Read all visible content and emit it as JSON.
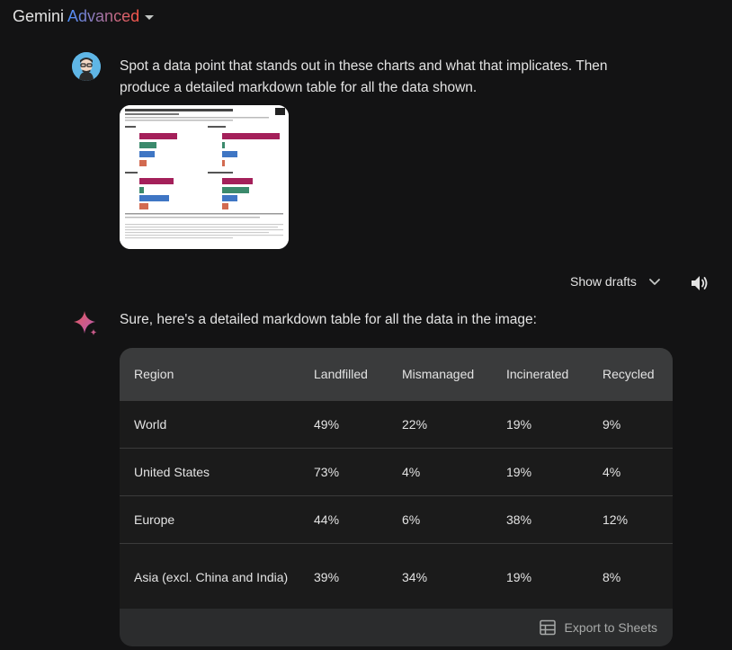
{
  "app": {
    "name_prefix": "Gemini",
    "name_suffix": "Advanced"
  },
  "user_message": "Spot a data point that stands out in these charts and what that implicates. Then produce a detailed markdown table for all the data shown.",
  "drafts": {
    "label": "Show drafts"
  },
  "reply": {
    "intro": "Sure, here's a detailed markdown table for all the data in the image:",
    "table": {
      "headers": [
        "Region",
        "Landfilled",
        "Mismanaged",
        "Incinerated",
        "Recycled"
      ],
      "rows": [
        [
          "World",
          "49%",
          "22%",
          "19%",
          "9%"
        ],
        [
          "United States",
          "73%",
          "4%",
          "19%",
          "4%"
        ],
        [
          "Europe",
          "44%",
          "6%",
          "38%",
          "12%"
        ],
        [
          "Asia (excl. China and India)",
          "39%",
          "34%",
          "19%",
          "8%"
        ]
      ]
    },
    "export_label": "Export to Sheets"
  },
  "icons": {
    "dropdown": "chevron-down-icon",
    "speaker": "speaker-icon",
    "spark": "gemini-spark-icon",
    "export": "table-icon"
  },
  "colors": {
    "background": "#131314",
    "table_header": "#3a3b3c",
    "text": "#e3e3e3"
  }
}
